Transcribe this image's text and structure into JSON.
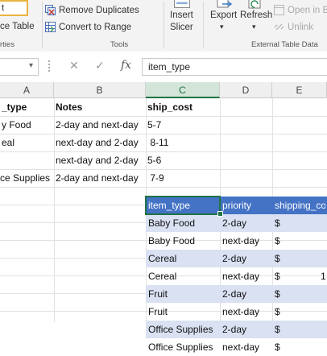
{
  "ribbon": {
    "name_box_fragment": "t",
    "properties_fragment": "ce Table",
    "properties_group": "rties",
    "remove_duplicates": "Remove Duplicates",
    "convert_to_range": "Convert to Range",
    "tools_group": "Tools",
    "insert_slicer_line1": "Insert",
    "insert_slicer_line2": "Slicer",
    "export": "Export",
    "refresh": "Refresh",
    "open_in_browser": "Open in Br",
    "unlink": "Unlink",
    "external_group": "External Table Data"
  },
  "formula_bar": {
    "cancel_glyph": "✕",
    "enter_glyph": "✓",
    "fx_glyph": "fx",
    "value": "item_type"
  },
  "columns": [
    "A",
    "B",
    "C",
    "D",
    "E"
  ],
  "source_table": {
    "headers": [
      "_type",
      "Notes",
      "ship_cost"
    ],
    "rows": [
      [
        "y Food",
        "2-day and next-day",
        "5-7"
      ],
      [
        "eal",
        "next-day and 2-day",
        " 8-11"
      ],
      [
        "",
        "next-day and 2-day",
        "5-6"
      ],
      [
        "ce Supplies",
        "2-day and next-day",
        " 7-9"
      ]
    ]
  },
  "result_table": {
    "headers": [
      "item_type",
      "priority",
      "shipping_co"
    ],
    "rows": [
      [
        "Baby Food",
        "2-day",
        "$",
        ""
      ],
      [
        "Baby Food",
        "next-day",
        "$",
        ""
      ],
      [
        "Cereal",
        "2-day",
        "$",
        ""
      ],
      [
        "Cereal",
        "next-day",
        "$",
        "1"
      ],
      [
        "Fruit",
        "2-day",
        "$",
        ""
      ],
      [
        "Fruit",
        "next-day",
        "$",
        ""
      ],
      [
        "Office Supplies",
        "2-day",
        "$",
        ""
      ],
      [
        "Office Supplies",
        "next-day",
        "$",
        ""
      ]
    ]
  },
  "colors": {
    "table_header": "#4472c4",
    "table_band": "#d9e1f2",
    "excel_green": "#217346"
  }
}
